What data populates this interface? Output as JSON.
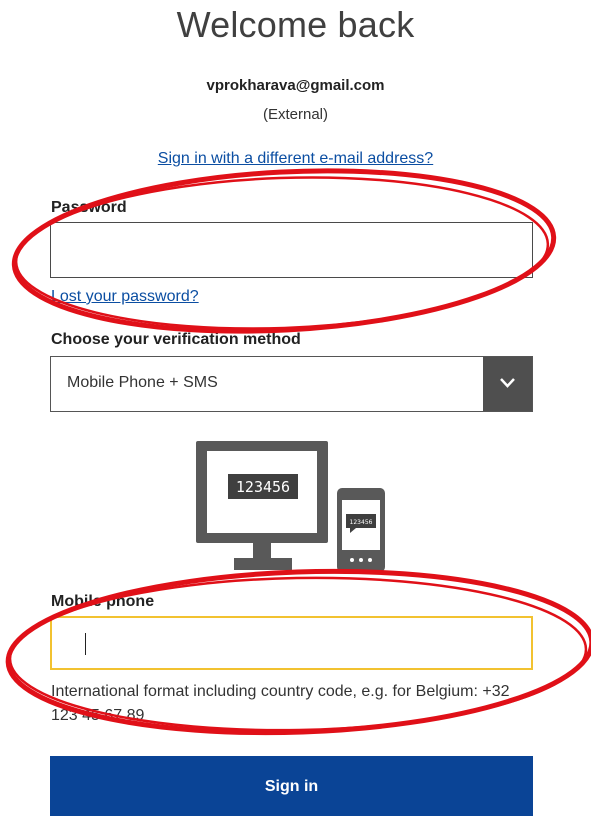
{
  "header": {
    "title": "Welcome back",
    "email": "vprokharava@gmail.com",
    "account_type": "(External)",
    "different_email_link": "Sign in with a different e-mail address?"
  },
  "password": {
    "label": "Password",
    "value": "",
    "lost_link": "Lost your password?"
  },
  "verification": {
    "label": "Choose your verification method",
    "selected": "Mobile Phone + SMS",
    "dropdown_icon": "chevron-down-icon"
  },
  "illustration": {
    "monitor_code": "123456",
    "phone_code": "123456"
  },
  "mobile": {
    "label": "Mobile phone",
    "value": "",
    "hint": "International format including country code, e.g. for Belgium: +32 123 45 67 89"
  },
  "submit": {
    "label": "Sign in"
  },
  "colors": {
    "link": "#0b4ea2",
    "button": "#0a4496",
    "focus_border": "#f2c230",
    "annotation": "#e01018"
  }
}
